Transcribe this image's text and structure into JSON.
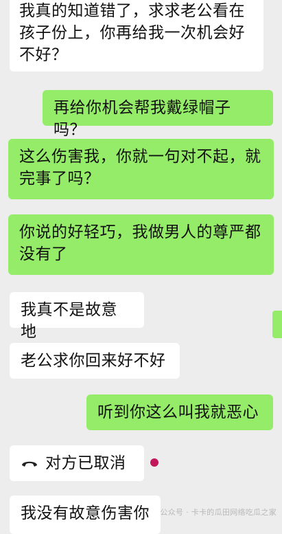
{
  "colors": {
    "background": "#ededed",
    "incoming_bubble": "#ffffff",
    "outgoing_bubble": "#95ec69",
    "indicator_dot": "#c2185b"
  },
  "messages": [
    {
      "side": "incoming",
      "text": "我真的知道错了，求求老公看在孩子份上，你再给我一次机会好不好？"
    },
    {
      "side": "outgoing",
      "text": "再给你机会帮我戴绿帽子吗？"
    },
    {
      "side": "outgoing",
      "text": "这么伤害我，你就一句对不起，就完事了吗？"
    },
    {
      "side": "outgoing",
      "text": "你说的好轻巧，我做男人的尊严都没有了"
    },
    {
      "side": "incoming",
      "text": "我真不是故意地"
    },
    {
      "side": "incoming",
      "text": "老公求你回来好不好"
    },
    {
      "side": "outgoing",
      "text": "听到你这么叫我就恶心"
    },
    {
      "side": "incoming",
      "type": "call",
      "icon": "hangup-phone-icon",
      "text": "对方已取消"
    },
    {
      "side": "incoming",
      "text": "我没有故意伤害你"
    }
  ],
  "watermark": "公众号 · 卡卡的瓜田网络吃瓜之家"
}
